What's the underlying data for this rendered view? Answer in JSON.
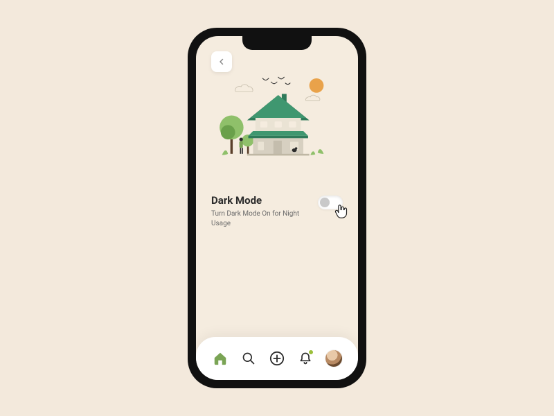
{
  "colors": {
    "bg": "#f3e9dc",
    "screen": "#f5ecdf",
    "accent": "#7aa455",
    "roof_dark": "#2f7a5a",
    "roof_light": "#3f9770",
    "window": "#e9e0cf",
    "sun": "#e9a24a",
    "tree_light": "#8fc06a",
    "tree_dark": "#6aa04b",
    "text": "#2b2b2b",
    "subtext": "#6b6b6b"
  },
  "header": {
    "back_label": "Back"
  },
  "setting": {
    "title": "Dark Mode",
    "subtitle": "Turn Dark Mode On for Night Usage",
    "toggle_state": "off"
  },
  "tabs": {
    "home": "Home",
    "search": "Search",
    "add": "Add",
    "notifications": "Notifications",
    "profile": "Profile",
    "notification_unread": true
  }
}
